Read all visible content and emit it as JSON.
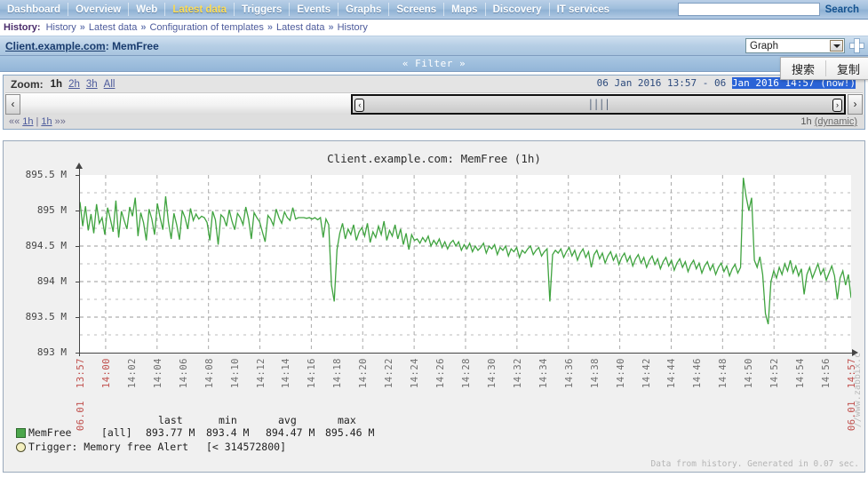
{
  "nav": {
    "items": [
      {
        "label": "Dashboard",
        "active": false
      },
      {
        "label": "Overview",
        "active": false
      },
      {
        "label": "Web",
        "active": false
      },
      {
        "label": "Latest data",
        "active": true
      },
      {
        "label": "Triggers",
        "active": false
      },
      {
        "label": "Events",
        "active": false
      },
      {
        "label": "Graphs",
        "active": false
      },
      {
        "label": "Screens",
        "active": false
      },
      {
        "label": "Maps",
        "active": false
      },
      {
        "label": "Discovery",
        "active": false
      },
      {
        "label": "IT services",
        "active": false
      }
    ],
    "search_value": "",
    "search_placeholder": "",
    "search_button": "Search"
  },
  "breadcrumb": {
    "title": "History:",
    "items": [
      "History",
      "Latest data",
      "Configuration of templates",
      "Latest data",
      "History"
    ],
    "separator": "»"
  },
  "host_bar": {
    "host": "Client.example.com",
    "separator": ": ",
    "item": "MemFree",
    "graph_select_value": "Graph",
    "add_button": "+"
  },
  "filter_bar": {
    "label": "« Filter »",
    "collapse_icon": "chevron-up-icon"
  },
  "time_selector": {
    "zoom_label": "Zoom:",
    "zoom_options": [
      {
        "label": "1h",
        "selected": true
      },
      {
        "label": "2h",
        "selected": false
      },
      {
        "label": "3h",
        "selected": false
      },
      {
        "label": "All",
        "selected": false
      }
    ],
    "range_from": "06 Jan 2016 13:57",
    "range_dash": "-",
    "range_to_plain": "06 ",
    "range_to_highlighted": "Jan 2016 14:57 (now!)",
    "prev_arrow": "‹",
    "next_arrow": "›",
    "grip_left": "‹",
    "grip_right": "›",
    "grip_middle": "||||",
    "pager_prev_sym": "««",
    "pager_prev": "1h",
    "pager_pipe": "|",
    "pager_next": "1h",
    "pager_next_sym": "»»",
    "period": "1h",
    "dynamic": "(dynamic)"
  },
  "graph": {
    "generated_note": "Data from history. Generated in 0.07 sec.",
    "watermark": "//www.zabbix.c",
    "legend_headers": [
      "last",
      "min",
      "avg",
      "max"
    ],
    "series_rows": [
      {
        "name": "MemFree",
        "scope": "[all]",
        "last": "893.77 M",
        "min": "893.4 M",
        "avg": "894.47 M",
        "max": "895.46 M",
        "swatch": "square",
        "color": "#4ca64c"
      }
    ],
    "trigger_row": {
      "label": "Trigger: Memory free Alert",
      "expression": "[< 314572800]",
      "swatch": "circle",
      "color": "#f5f0c0"
    }
  },
  "context_menu": {
    "items": [
      "搜索",
      "复制"
    ]
  },
  "chart_data": {
    "type": "line",
    "title": "Client.example.com: MemFree (1h)",
    "xlabel": "",
    "ylabel": "",
    "ylim": [
      893,
      895.5
    ],
    "yunit": "M",
    "ytick_labels": [
      "895.5 M",
      "895 M",
      "894.5 M",
      "894 M",
      "893.5 M",
      "893 M"
    ],
    "ytick_values": [
      895.5,
      895,
      894.5,
      894,
      893.5,
      893
    ],
    "grid": true,
    "grid_minor": true,
    "legend_position": "below",
    "xtick_labels": [
      "13:57",
      "14:00",
      "14:02",
      "14:04",
      "14:06",
      "14:08",
      "14:10",
      "14:12",
      "14:14",
      "14:16",
      "14:18",
      "14:20",
      "14:22",
      "14:24",
      "14:26",
      "14:28",
      "14:30",
      "14:32",
      "14:34",
      "14:36",
      "14:38",
      "14:40",
      "14:42",
      "14:44",
      "14:46",
      "14:48",
      "14:50",
      "14:52",
      "14:54",
      "14:56",
      "14:57"
    ],
    "xedge_dates": [
      "06.01",
      "06.01"
    ],
    "xrange": [
      "13:57",
      "14:57"
    ],
    "series": [
      {
        "name": "MemFree",
        "color": "#3fa33f",
        "unit": "M",
        "stats": {
          "last": 893.77,
          "min": 893.4,
          "avg": 894.47,
          "max": 895.46
        },
        "values": [
          895.12,
          894.78,
          895.06,
          894.72,
          894.95,
          894.68,
          895.09,
          894.82,
          894.9,
          894.66,
          895.04,
          894.88,
          894.7,
          895.14,
          894.62,
          894.99,
          894.86,
          894.74,
          895.05,
          894.92,
          895.18,
          894.64,
          894.97,
          894.83,
          894.58,
          895.02,
          894.88,
          894.66,
          895.1,
          894.9,
          894.73,
          895.2,
          894.84,
          894.6,
          894.96,
          894.8,
          894.59,
          895.0,
          894.9,
          894.74,
          895.03,
          894.86,
          894.95,
          894.88,
          894.92,
          894.9,
          894.83,
          894.58,
          894.99,
          894.87,
          894.52,
          894.94,
          894.9,
          894.78,
          895.01,
          894.85,
          894.73,
          894.96,
          894.9,
          894.8,
          895.05,
          894.88,
          894.6,
          894.97,
          894.9,
          894.84,
          894.7,
          894.56,
          894.93,
          894.88,
          894.79,
          895.02,
          894.9,
          894.82,
          894.98,
          894.9,
          894.86,
          895.04,
          894.88,
          894.9,
          894.9,
          894.9,
          894.89,
          894.9,
          894.88,
          894.9,
          894.87,
          894.9,
          894.62,
          894.88,
          894.8,
          893.95,
          893.72,
          894.45,
          894.68,
          894.82,
          894.6,
          894.74,
          894.66,
          894.8,
          894.58,
          894.7,
          894.76,
          894.64,
          894.82,
          894.55,
          894.7,
          894.62,
          894.78,
          894.66,
          894.85,
          894.58,
          894.72,
          894.64,
          894.8,
          894.6,
          894.74,
          894.52,
          894.68,
          894.45,
          894.66,
          894.58,
          894.6,
          894.54,
          894.62,
          894.56,
          894.64,
          894.5,
          894.58,
          894.52,
          894.6,
          894.48,
          894.56,
          894.46,
          894.54,
          894.58,
          894.5,
          894.56,
          894.44,
          894.52,
          894.46,
          894.54,
          894.42,
          894.5,
          894.44,
          894.48,
          894.54,
          894.4,
          894.5,
          894.46,
          894.52,
          894.38,
          894.48,
          894.44,
          894.5,
          894.36,
          894.46,
          894.42,
          894.48,
          894.34,
          894.44,
          894.4,
          894.46,
          894.5,
          894.38,
          894.44,
          894.48,
          894.36,
          894.42,
          894.46,
          893.72,
          894.38,
          894.44,
          894.4,
          894.46,
          894.34,
          894.42,
          894.48,
          894.36,
          894.44,
          894.3,
          894.4,
          894.46,
          894.34,
          894.42,
          894.2,
          894.38,
          894.44,
          894.32,
          894.4,
          894.26,
          894.36,
          894.42,
          894.3,
          894.38,
          894.24,
          894.34,
          894.4,
          894.28,
          894.36,
          894.22,
          894.32,
          894.38,
          894.26,
          894.34,
          894.2,
          894.3,
          894.36,
          894.24,
          894.32,
          894.18,
          894.28,
          894.34,
          894.22,
          894.3,
          894.16,
          894.26,
          894.32,
          894.2,
          894.28,
          894.14,
          894.24,
          894.3,
          894.18,
          894.26,
          894.12,
          894.22,
          894.28,
          894.16,
          894.24,
          894.1,
          894.2,
          894.26,
          894.14,
          894.22,
          894.08,
          894.18,
          894.24,
          894.12,
          894.2,
          895.46,
          895.2,
          895.0,
          895.18,
          894.3,
          894.2,
          894.35,
          894.1,
          893.55,
          893.4,
          894.0,
          894.15,
          894.05,
          894.2,
          894.1,
          894.25,
          894.15,
          894.3,
          894.12,
          894.22,
          894.08,
          894.18,
          893.82,
          894.1,
          894.2,
          894.05,
          894.15,
          894.25,
          894.1,
          894.18,
          894.02,
          894.12,
          894.22,
          894.08,
          893.75,
          894.05,
          894.15,
          893.95,
          894.1,
          893.77
        ]
      }
    ]
  }
}
